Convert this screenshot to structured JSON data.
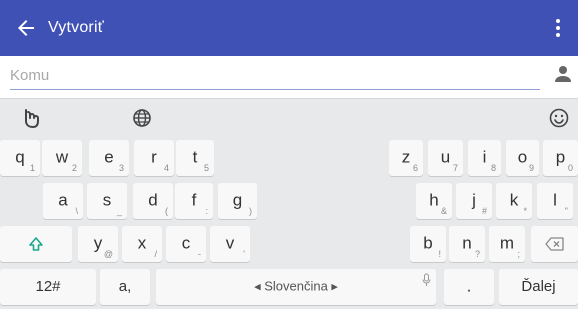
{
  "header": {
    "title": "Vytvoriť",
    "back_icon": "arrow-left-icon",
    "menu_icon": "more-vert-icon",
    "color": "#3f51b5"
  },
  "to_field": {
    "placeholder": "Komu",
    "value": "",
    "icon": "person-icon"
  },
  "keyboard_toolbar": {
    "icons": [
      "gesture-touch-icon",
      "globe-icon",
      "emoji-icon"
    ]
  },
  "keyboard": {
    "row1": [
      {
        "label": "q",
        "hint": "1"
      },
      {
        "label": "w",
        "hint": "2"
      },
      {
        "label": "e",
        "hint": "3"
      },
      {
        "label": "r",
        "hint": "4"
      },
      {
        "label": "t",
        "hint": "5"
      },
      {
        "label": "z",
        "hint": "6"
      },
      {
        "label": "u",
        "hint": "7"
      },
      {
        "label": "i",
        "hint": "8"
      },
      {
        "label": "o",
        "hint": "9"
      },
      {
        "label": "p",
        "hint": "0"
      }
    ],
    "row2": [
      {
        "label": "a",
        "hint": "\\"
      },
      {
        "label": "s",
        "hint": "_"
      },
      {
        "label": "d",
        "hint": "("
      },
      {
        "label": "f",
        "hint": ":"
      },
      {
        "label": "g",
        "hint": ")"
      },
      {
        "label": "h",
        "hint": "&"
      },
      {
        "label": "j",
        "hint": "#"
      },
      {
        "label": "k",
        "hint": "*"
      },
      {
        "label": "l",
        "hint": "\""
      }
    ],
    "row3": [
      {
        "label": "y",
        "hint": "@"
      },
      {
        "label": "x",
        "hint": "/"
      },
      {
        "label": "c",
        "hint": "-"
      },
      {
        "label": "v",
        "hint": "'"
      },
      {
        "label": "b",
        "hint": "!"
      },
      {
        "label": "n",
        "hint": "?"
      },
      {
        "label": "m",
        "hint": ";"
      }
    ],
    "shift_icon": "shift-icon",
    "backspace_icon": "backspace-icon",
    "symbols_label": "12#",
    "comma_label": "a,",
    "comma_hint": "?",
    "space_label": "◂ Slovenčina ▸",
    "mic_icon": "microphone-icon",
    "period_label": ".",
    "enter_label": "Ďalej",
    "accent_color": "#1aa88c"
  }
}
